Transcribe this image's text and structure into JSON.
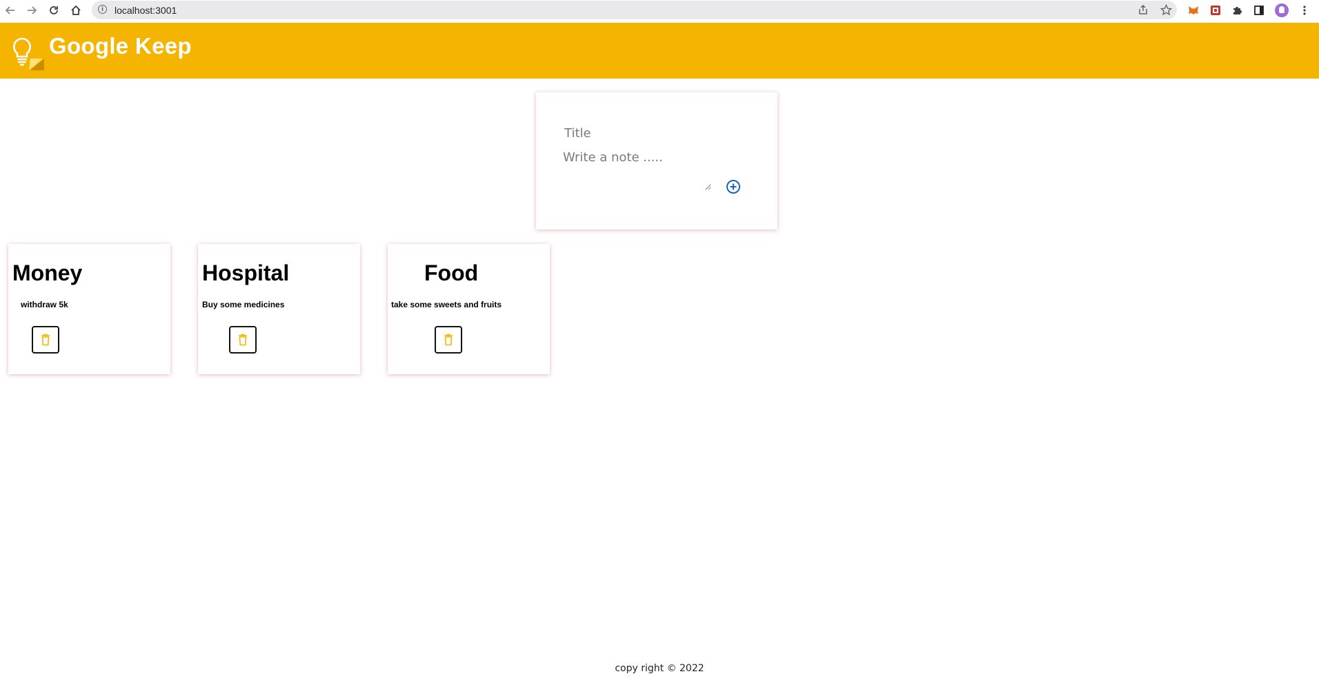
{
  "browser": {
    "url": "localhost:3001",
    "icons": [
      "back-icon",
      "forward-icon",
      "reload-icon",
      "home-icon",
      "site-info-icon",
      "share-icon",
      "bookmark-star-icon",
      "metamask-icon",
      "extension-icon",
      "puzzle-icon",
      "side-panel-icon",
      "profile-avatar",
      "menu-icon"
    ]
  },
  "app": {
    "title": "Google Keep",
    "brand_color": "#f5b400",
    "accent_color": "#1565c0"
  },
  "create_note": {
    "title_placeholder": "Title",
    "content_placeholder": "Write a note .....",
    "add_icon": "plus-circle-icon"
  },
  "notes": [
    {
      "title": "Money",
      "content": "withdraw 5k",
      "delete_icon": "trash-icon"
    },
    {
      "title": "Hospital",
      "content": "Buy some medicines",
      "delete_icon": "trash-icon"
    },
    {
      "title": "Food",
      "content": "take some sweets and fruits",
      "delete_icon": "trash-icon"
    }
  ],
  "footer": {
    "text": "copy right © 2022"
  }
}
